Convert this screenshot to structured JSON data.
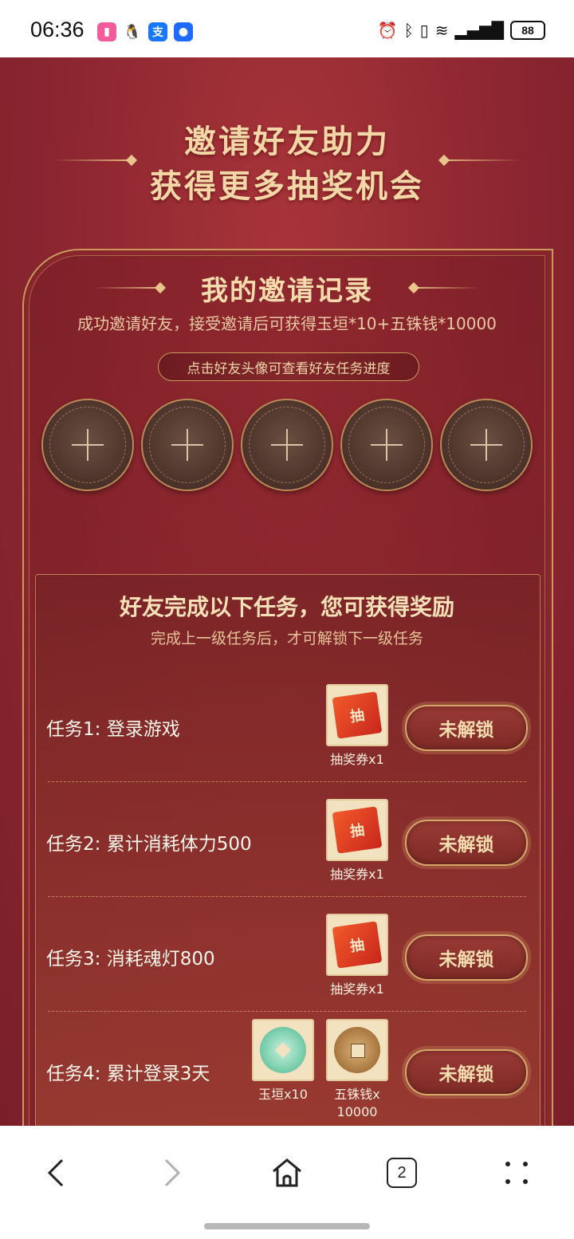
{
  "status_bar": {
    "time": "06:36",
    "battery": "88",
    "apps": [
      {
        "icon": "app-icon-pink",
        "color": "#f45b9c"
      },
      {
        "icon": "qq-icon",
        "color": "#111111"
      },
      {
        "icon": "alipay-icon",
        "color": "#1677ff",
        "glyph": "支"
      },
      {
        "icon": "app-icon-blue",
        "color": "#1f6bff"
      }
    ]
  },
  "header": {
    "line1": "邀请好友助力",
    "line2": "获得更多抽奖机会"
  },
  "invite": {
    "title": "我的邀请记录",
    "subtitle": "成功邀请好友，接受邀请后可获得玉垣*10+五铢钱*10000",
    "hint": "点击好友头像可查看好友任务进度",
    "slots": 5
  },
  "tasks": {
    "title": "好友完成以下任务，您可获得奖励",
    "subtitle": "完成上一级任务后，才可解锁下一级任务",
    "items": [
      {
        "label": "任务1:  登录游戏",
        "button": "未解锁",
        "rewards": [
          {
            "type": "ticket",
            "glyph": "抽",
            "caption": "抽奖券x1"
          }
        ]
      },
      {
        "label": "任务2:  累计消耗体力500",
        "button": "未解锁",
        "rewards": [
          {
            "type": "ticket",
            "glyph": "抽",
            "caption": "抽奖券x1"
          }
        ]
      },
      {
        "label": "任务3:  消耗魂灯800",
        "button": "未解锁",
        "rewards": [
          {
            "type": "ticket",
            "glyph": "抽",
            "caption": "抽奖券x1"
          }
        ]
      },
      {
        "label": "任务4:  累计登录3天",
        "button": "未解锁",
        "rewards": [
          {
            "type": "jade",
            "caption": "玉垣x10"
          },
          {
            "type": "coin",
            "caption": "五铢钱x\n10000"
          }
        ]
      }
    ]
  },
  "bottom_nav": {
    "tab_count": "2"
  },
  "colors": {
    "page_bg": "#8c2630",
    "gold": "#f3d7a6",
    "button_bg": "#7e2a26"
  }
}
